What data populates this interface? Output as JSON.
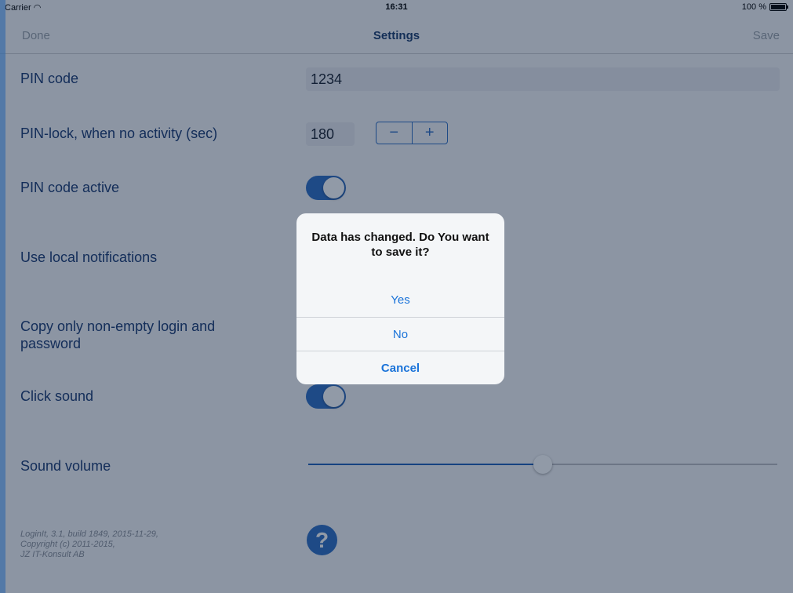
{
  "status_bar": {
    "carrier": "Carrier",
    "time": "16:31",
    "battery": "100 %"
  },
  "nav": {
    "left": "Done",
    "title": "Settings",
    "right": "Save"
  },
  "settings": {
    "pin_code_label": "PIN code",
    "pin_code_value": "1234",
    "pin_lock_label": "PIN-lock, when no activity (sec)",
    "pin_lock_value": "180",
    "stepper_minus": "−",
    "stepper_plus": "+",
    "pin_active_label": "PIN code active",
    "pin_active_on": true,
    "notifications_label": "Use local notifications",
    "copy_label": "Copy only non-empty login and password",
    "click_sound_label": "Click sound",
    "click_sound_on": true,
    "volume_label": "Sound volume",
    "volume_fraction": 0.5
  },
  "footer": {
    "line1": "LoginIt, 3.1, build 1849, 2015-11-29,",
    "line2": "Copyright (c) 2011-2015,",
    "line3": "JZ IT-Konsult AB",
    "help_glyph": "?"
  },
  "alert": {
    "message": "Data has changed. Do You want to save it?",
    "yes": "Yes",
    "no": "No",
    "cancel": "Cancel"
  },
  "colors": {
    "accent": "#2f6ec4",
    "label": "#1a3a72",
    "alert_button": "#1a73d9"
  }
}
